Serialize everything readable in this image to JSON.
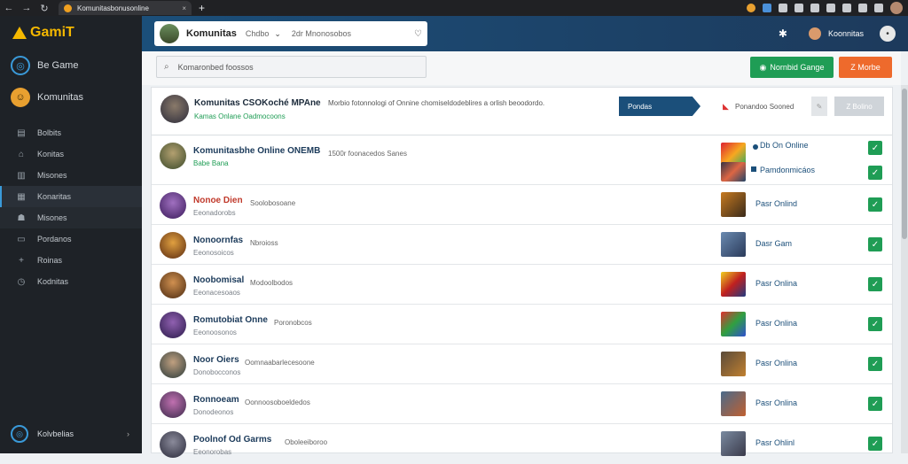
{
  "browser": {
    "tab_title": "Komunitasbonusonline",
    "tab_close": "×",
    "new_tab": "+"
  },
  "sidebar": {
    "logo": "GamiT",
    "primary": [
      {
        "label": "Be Game",
        "icon": "ring-icon"
      },
      {
        "label": "Komunitas",
        "icon": "face-icon"
      }
    ],
    "items": [
      {
        "label": "Bolbits",
        "icon": "stack-icon"
      },
      {
        "label": "Konitas",
        "icon": "home-icon"
      },
      {
        "label": "Misones",
        "icon": "building-icon"
      },
      {
        "label": "Konaritas",
        "icon": "grid-icon"
      },
      {
        "label": "Misones",
        "icon": "users-icon"
      },
      {
        "label": "Pordanos",
        "icon": "folder-icon"
      },
      {
        "label": "Roinas",
        "icon": "plus-icon"
      },
      {
        "label": "Kodnitas",
        "icon": "clock-icon"
      }
    ],
    "footer": "Kolvbelias"
  },
  "header": {
    "selector_title": "Komunitas",
    "selector_mid": "Chdbo",
    "selector_right": "2dr Mnonosobos",
    "user_name": "Koonnitas"
  },
  "toolbar": {
    "search_placeholder": "Komaronbed foossos",
    "green_button": "Nornbid Gange",
    "orange_button": "Z Morbe"
  },
  "top_row": {
    "title": "Komunitas CSOKoché MPAne",
    "description": "Morbio fotonnologi of Onnine chomiseldodeblires a orlish beoodordo.",
    "subtitle": "Kamas Onlane Oadmocoons",
    "arrow_button": "Pondas",
    "right_text": "Ponandoo Sooned",
    "gray_button": "Z Bolino"
  },
  "rows": [
    {
      "name": "Komunitasbhe Online ONEMB",
      "sub": "Babe Bana",
      "desc": "1500r foonacedos Sanes",
      "game1": "Db On Online",
      "game2": "Pamdonmicáos"
    },
    {
      "name": "Nonoe Dien",
      "sub": "Eeonadorobs",
      "desc": "Soolobosoane",
      "game": "Pasr Onlind"
    },
    {
      "name": "Nonoornfas",
      "sub": "Eeonosoicos",
      "desc": "Nbroioss",
      "game": "Dasr Gam"
    },
    {
      "name": "Noobomisal",
      "sub": "Eeonacesoaos",
      "desc": "Modoolbodos",
      "game": "Pasr Onlina"
    },
    {
      "name": "Romutobiat Onne",
      "sub": "Eeonoosonos",
      "desc": "Poronobcos",
      "game": "Pasr Onlina"
    },
    {
      "name": "Noor Oiers",
      "sub": "Donobocconos",
      "desc": "Oomnaabarlecesoone",
      "game": "Pasr Onlina"
    },
    {
      "name": "Ronnoeam",
      "sub": "Donodeonos",
      "desc": "Oonnoosoboeldedos",
      "game": "Pasr Onlina"
    },
    {
      "name": "Poolnof Od Garms",
      "sub": "Eeonorobas",
      "desc": "Oboleeiboroo",
      "game": "Pasr Ohlinl"
    }
  ],
  "colors": {
    "accent": "#1b4f7a",
    "success": "#1f9d55",
    "warning": "#ee6a2c",
    "sidebar_bg": "#1e2227"
  }
}
